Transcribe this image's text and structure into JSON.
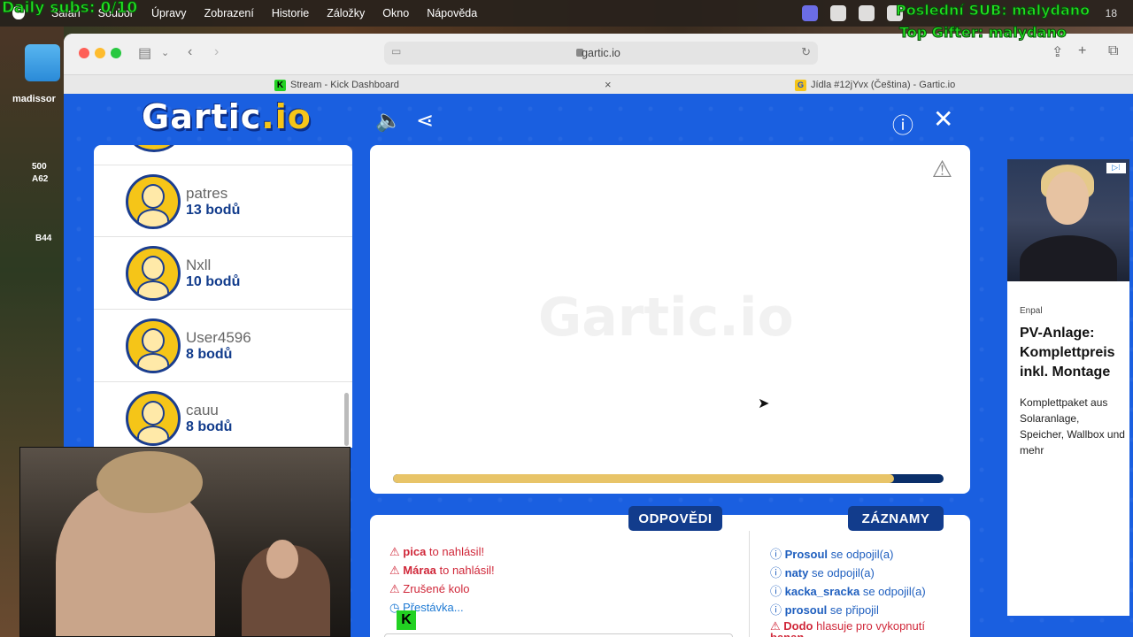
{
  "overlays": {
    "daily_subs": "Daily subs: 0/10",
    "last_sub": "Poslední SUB: malydano",
    "top_gifter": "Top Gifter: malydano"
  },
  "menubar": {
    "items": [
      "Safari",
      "Soubor",
      "Úpravy",
      "Zobrazení",
      "Historie",
      "Záložky",
      "Okno",
      "Nápověda"
    ],
    "clock": "18"
  },
  "desktop": {
    "label1": "madissor",
    "label2a": "500",
    "label2b": "A62",
    "label3": "B44"
  },
  "browser": {
    "url": "gartic.io",
    "tabs": [
      {
        "title": "Stream - Kick Dashboard",
        "favicon": "K"
      },
      {
        "title": "Jídla #12jYvx (Čeština) - Gartic.io",
        "favicon": "G"
      }
    ]
  },
  "gartic": {
    "logo_main": "Gartic",
    "logo_suffix": ".io",
    "players": [
      {
        "name": "patres",
        "score": "13 bodů"
      },
      {
        "name": "Nxll",
        "score": "10 bodů"
      },
      {
        "name": "User4596",
        "score": "8 bodů"
      },
      {
        "name": "cauu",
        "score": "8 bodů"
      }
    ],
    "timer_fraction": 0.91,
    "answers_label": "ODPOVĚDI",
    "log_label": "ZÁZNAMY",
    "answers": [
      {
        "icon": "warning-icon",
        "user": "pica",
        "text": "to nahlásil!"
      },
      {
        "icon": "warning-icon",
        "user": "Máraa",
        "text": "to nahlásil!"
      },
      {
        "icon": "warning-icon",
        "user": "",
        "text": "Zrušené kolo"
      },
      {
        "icon": "clock-icon",
        "user": "",
        "text": "Přestávka..."
      }
    ],
    "log": [
      {
        "icon": "info-icon",
        "user": "Prosoul",
        "text": "se odpojil(a)"
      },
      {
        "icon": "info-icon",
        "user": "naty",
        "text": "se odpojil(a)"
      },
      {
        "icon": "info-icon",
        "user": "kacka_sracka",
        "text": "se odpojil(a)"
      },
      {
        "icon": "info-icon",
        "user": "prosoul",
        "text": "se připojil"
      },
      {
        "icon": "warning-icon",
        "user": "Dodo",
        "text": "hlasuje pro vykopnutí"
      },
      {
        "icon": "",
        "user": "",
        "text": "banan"
      }
    ],
    "colors": {
      "brand_blue": "#1a5fe0",
      "accent_yellow": "#f5c518",
      "dark_navy": "#123c8c"
    }
  },
  "ad": {
    "sponsor": "Enpal",
    "title": "PV-Anlage: Komplettpreis inkl. Montage",
    "body": "Komplettpaket aus Solaranlage, Speicher, Wallbox und mehr"
  }
}
